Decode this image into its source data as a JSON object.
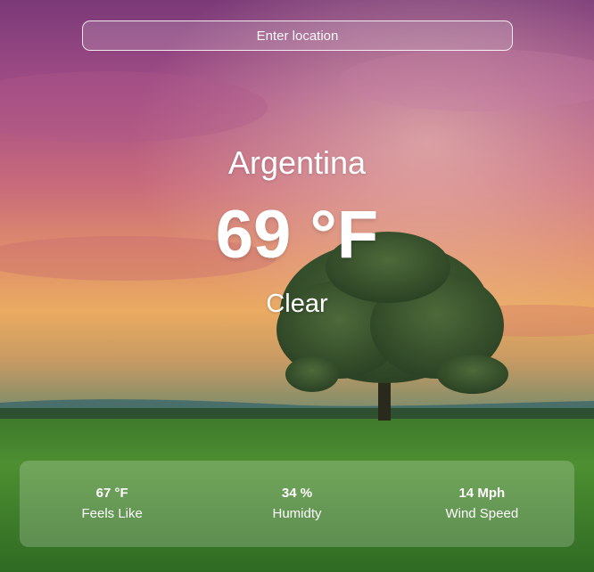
{
  "search": {
    "placeholder": "Enter location"
  },
  "weather": {
    "location": "Argentina",
    "temperature": "69 °F",
    "condition": "Clear"
  },
  "stats": [
    {
      "value": "67 °F",
      "label": "Feels Like"
    },
    {
      "value": "34 %",
      "label": "Humidty"
    },
    {
      "value": "14 Mph",
      "label": "Wind Speed"
    }
  ]
}
